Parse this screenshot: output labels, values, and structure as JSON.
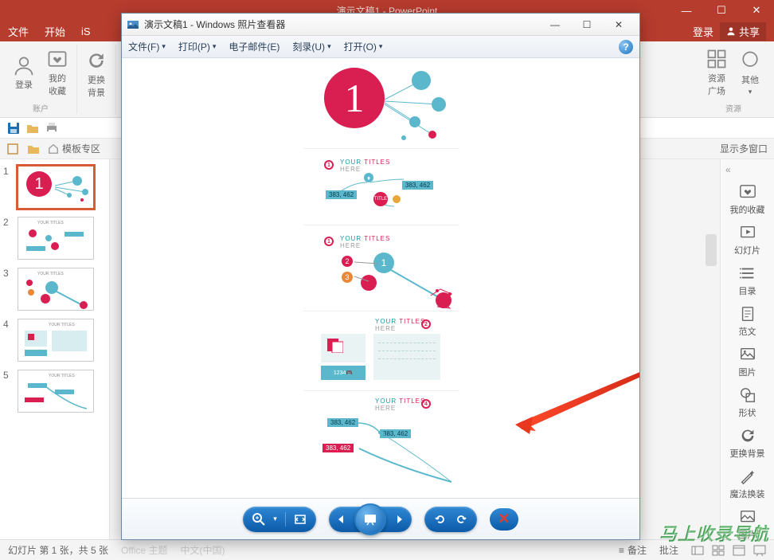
{
  "ppt": {
    "titlebar_title": "演示文稿1 - PowerPoint",
    "menu": {
      "file": "文件",
      "home": "开始",
      "is": "iS",
      "login": "登录",
      "share": "共享"
    },
    "ribbon": {
      "account_group": "账户",
      "login_btn": "登录",
      "favorites_btn": "我的\n收藏",
      "bg_btn": "更换\n背景",
      "resource_group": "资源",
      "resource_btn": "资源\n广场",
      "other_btn": "其他"
    },
    "secondbar": {
      "template_area": "模板专区",
      "multiwindow": "显示多窗口"
    },
    "status": {
      "slide_info": "幻灯片 第 1 张，共 5 张",
      "office_theme": "Office 主题",
      "chinese": "中文(中国)",
      "notes": "备注",
      "comments": "批注"
    },
    "thumbs": [
      "1",
      "2",
      "3",
      "4",
      "5"
    ],
    "right_panel": {
      "favorites": "我的收藏",
      "slideshow": "幻灯片",
      "toc": "目录",
      "model": "范文",
      "images": "图片",
      "shapes": "形状",
      "change_bg": "更换背景",
      "magic": "魔法换装",
      "pic": "图片"
    }
  },
  "viewer": {
    "title": "演示文稿1 - Windows 照片查看器",
    "menu": {
      "file": "文件(F)",
      "print": "打印(P)",
      "email": "电子邮件(E)",
      "burn": "刻录(U)",
      "open": "打开(O)"
    }
  },
  "slide_content": {
    "big_number": "1",
    "titles": {
      "your": "YOUR",
      "titles": "TITLES",
      "here": "HERE"
    },
    "title_word": "TITLE",
    "badge1": "383, 462",
    "badge2": "383, 462",
    "tiny_nums": "1234",
    "bullets": [
      "1",
      "2",
      "3",
      "4"
    ]
  },
  "watermark": "马上收录导航"
}
